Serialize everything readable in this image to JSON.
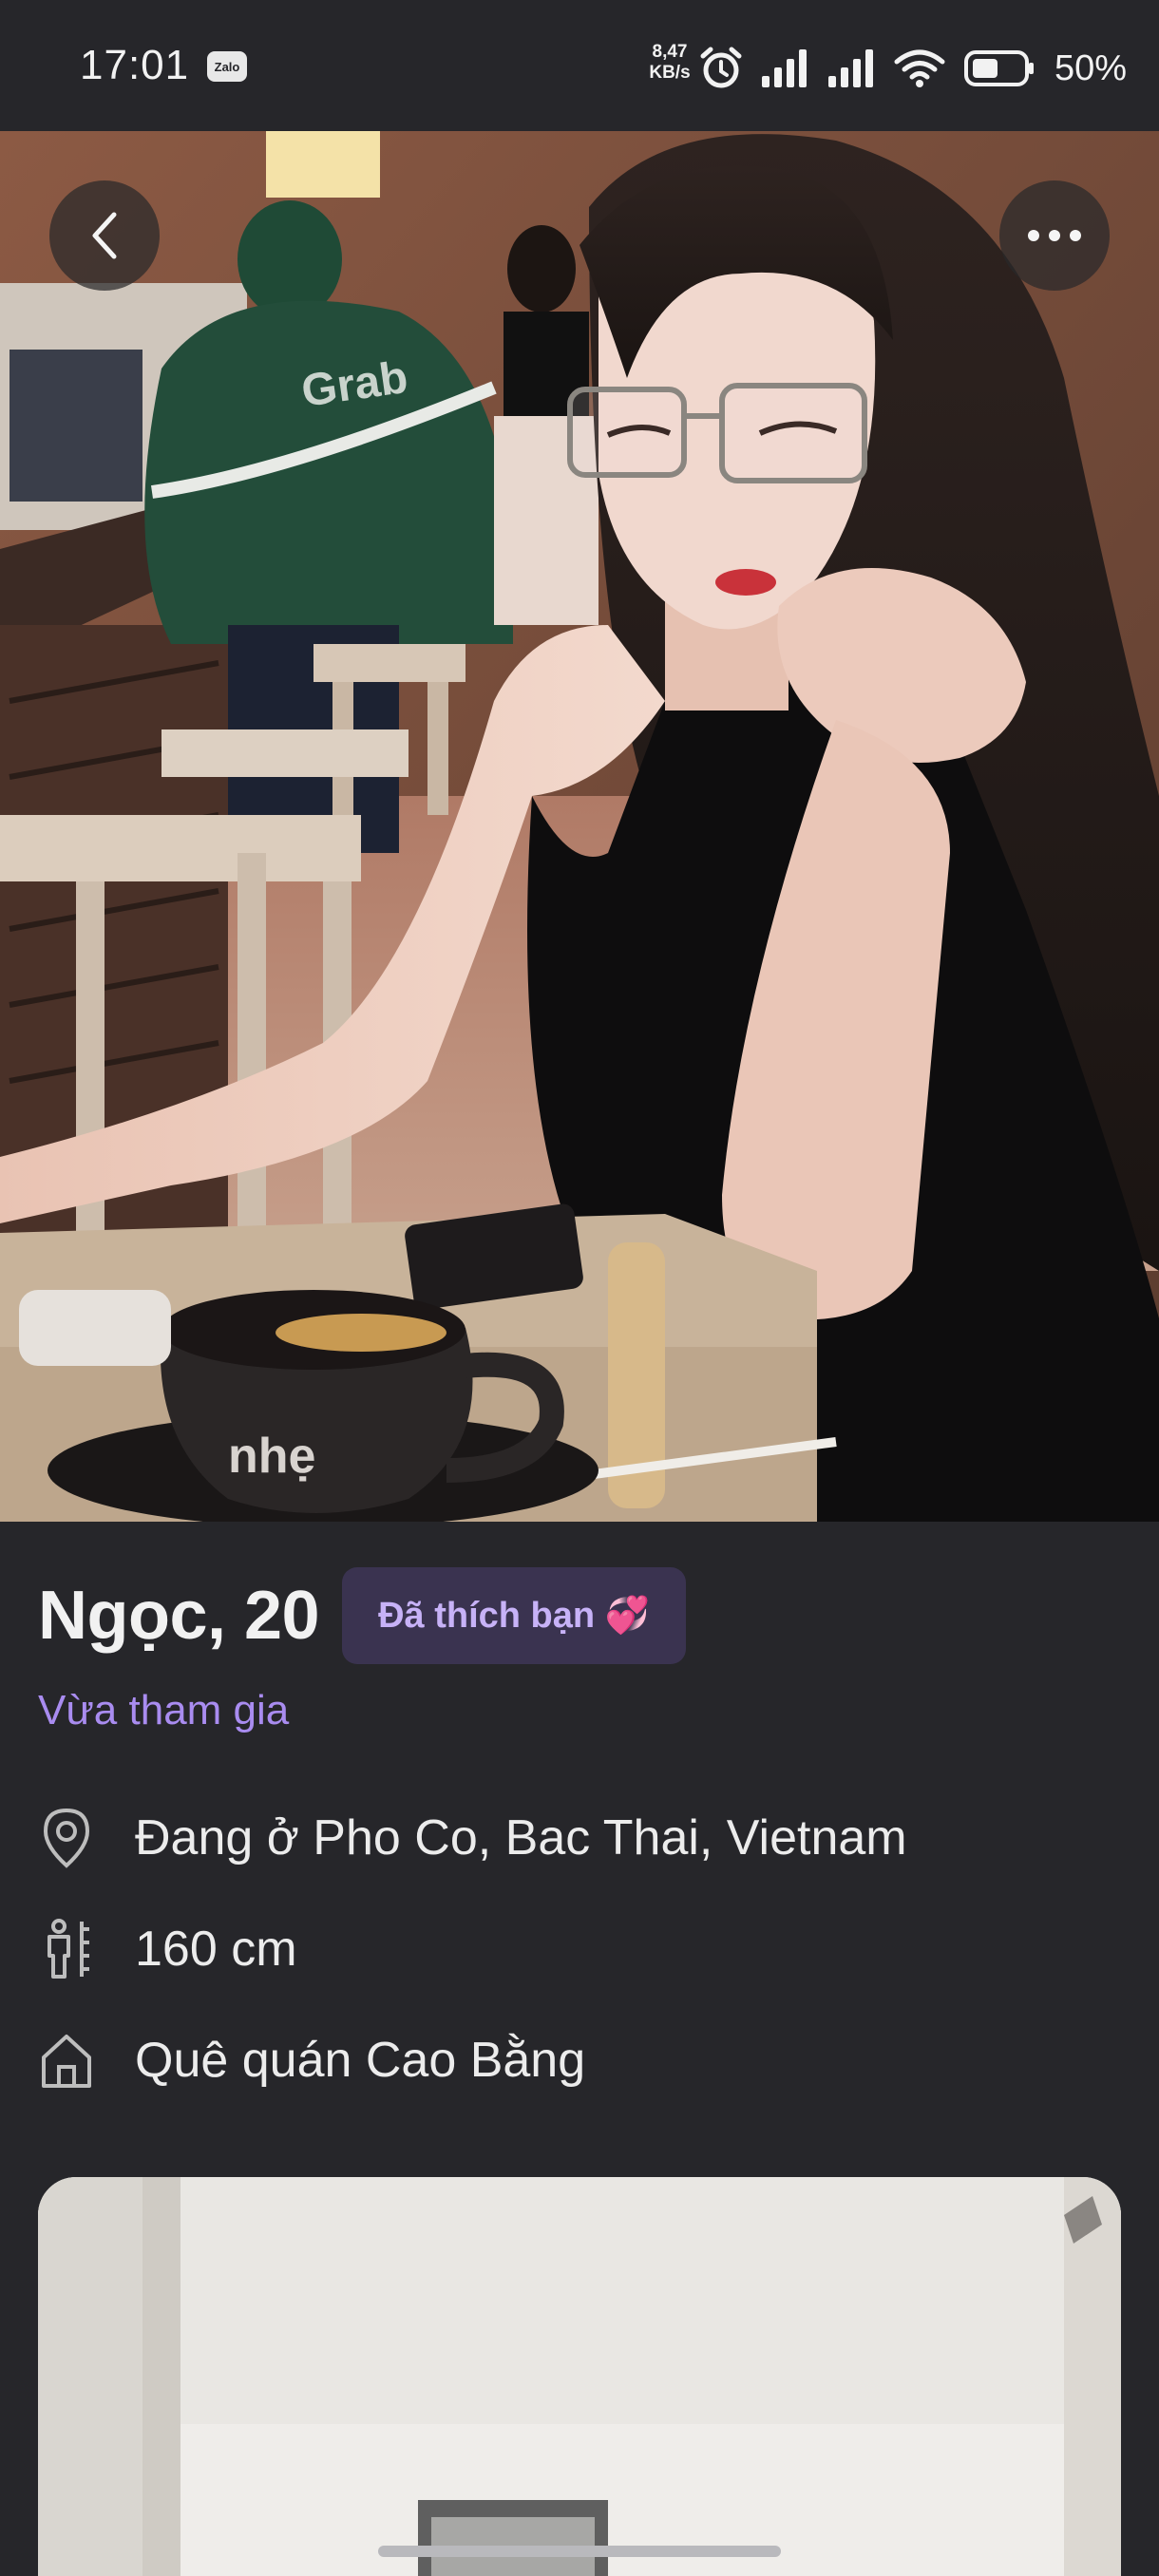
{
  "status_bar": {
    "time": "17:01",
    "app_icon_label": "Zalo",
    "net_speed_value": "8,47",
    "net_speed_unit": "KB/s",
    "battery": "50%",
    "icons": [
      "alarm-icon",
      "signal-icon",
      "signal-icon",
      "wifi-icon",
      "battery-icon"
    ]
  },
  "header": {
    "back_icon": "chevron-left-icon",
    "more_icon": "more-horizontal-icon"
  },
  "profile": {
    "name_age": "Ngọc, 20",
    "liked_badge": "Đã thích bạn 💞",
    "joined": "Vừa tham gia",
    "details": [
      {
        "icon": "location-pin-icon",
        "text": "Đang ở Pho Co, Bac Thai, Vietnam"
      },
      {
        "icon": "height-icon",
        "text": "160 cm"
      },
      {
        "icon": "home-icon",
        "text": "Quê quán Cao Bằng"
      }
    ]
  },
  "colors": {
    "background": "#26262a",
    "accent": "#a98cf0",
    "badge_bg": "#3a3350",
    "badge_text": "#c7b2f7"
  }
}
